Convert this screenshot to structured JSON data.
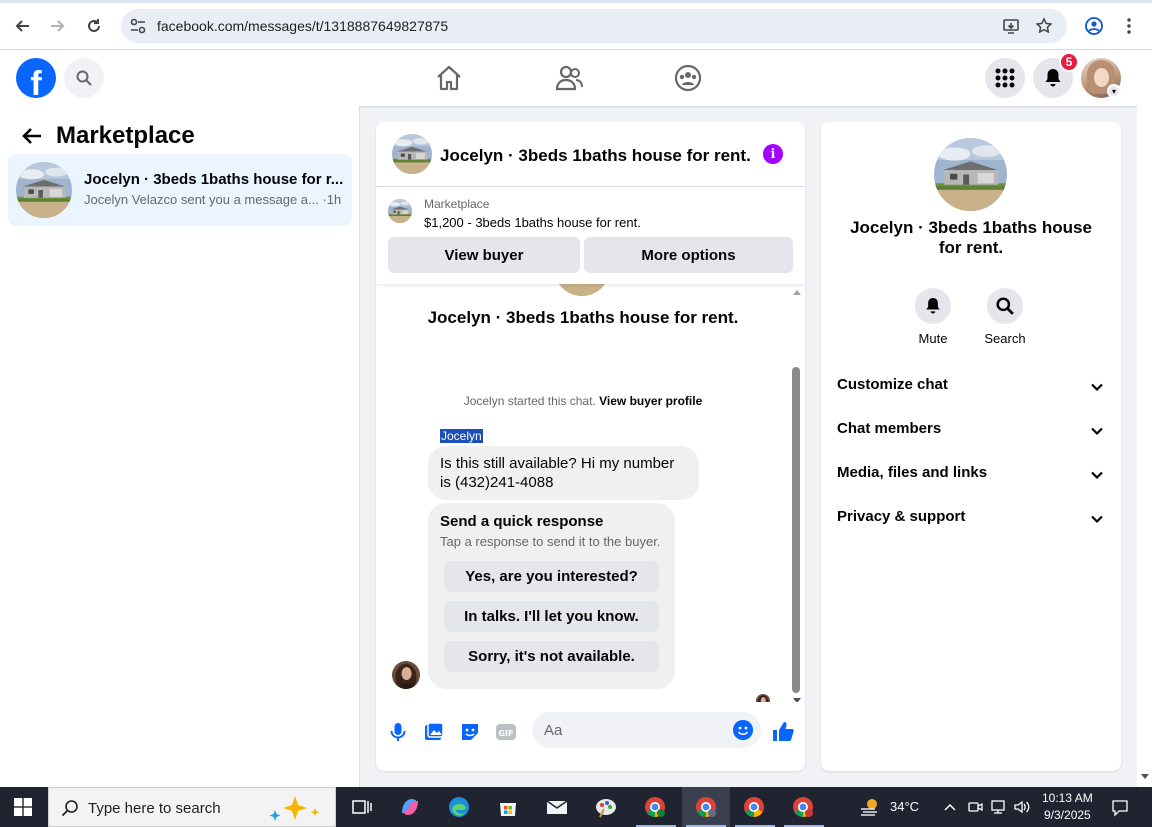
{
  "browser": {
    "url": "facebook.com/messages/t/1318887649827875"
  },
  "header": {
    "notification_count": "5",
    "icons": [
      "facebook-logo",
      "search-icon",
      "home-icon",
      "friends-icon",
      "groups-icon",
      "menu-grid-icon",
      "bell-icon",
      "profile-avatar"
    ]
  },
  "left": {
    "title": "Marketplace",
    "chat": {
      "title": "Jocelyn · 3beds 1baths house for r...",
      "preview": "Jocelyn Velazco sent you a message a... ·1h"
    }
  },
  "conversation": {
    "title": "Jocelyn · 3beds 1baths house for rent.",
    "marketplace_label": "Marketplace",
    "listing": "$1,200 - 3beds 1baths house for rent.",
    "view_buyer": "View buyer",
    "more_options": "More options",
    "big_title": "Jocelyn · 3beds 1baths house for rent.",
    "started_prefix": "Jocelyn started this chat.",
    "started_link": "View buyer profile",
    "sender_name": "Jocelyn",
    "message": "Is this still available? Hi my number is (432)241-4088",
    "quick_title": "Send a quick response",
    "quick_sub": "Tap a response to send it to the buyer.",
    "quick_options": [
      "Yes, are you interested?",
      "In talks. I'll let you know.",
      "Sorry, it's not available."
    ],
    "composer_placeholder": "Aa"
  },
  "right": {
    "title": "Jocelyn · 3beds 1baths house for rent.",
    "mute": "Mute",
    "search": "Search",
    "sections": [
      "Customize chat",
      "Chat members",
      "Media, files and links",
      "Privacy & support"
    ]
  },
  "taskbar": {
    "search_placeholder": "Type here to search",
    "weather": "34°C",
    "time": "10:13 AM",
    "date": "9/3/2025"
  },
  "colors": {
    "fb_blue": "#0866ff",
    "selected_chat": "#ebf5ff",
    "info_purple": "#a200ff",
    "badge_red": "#e41e3f"
  }
}
